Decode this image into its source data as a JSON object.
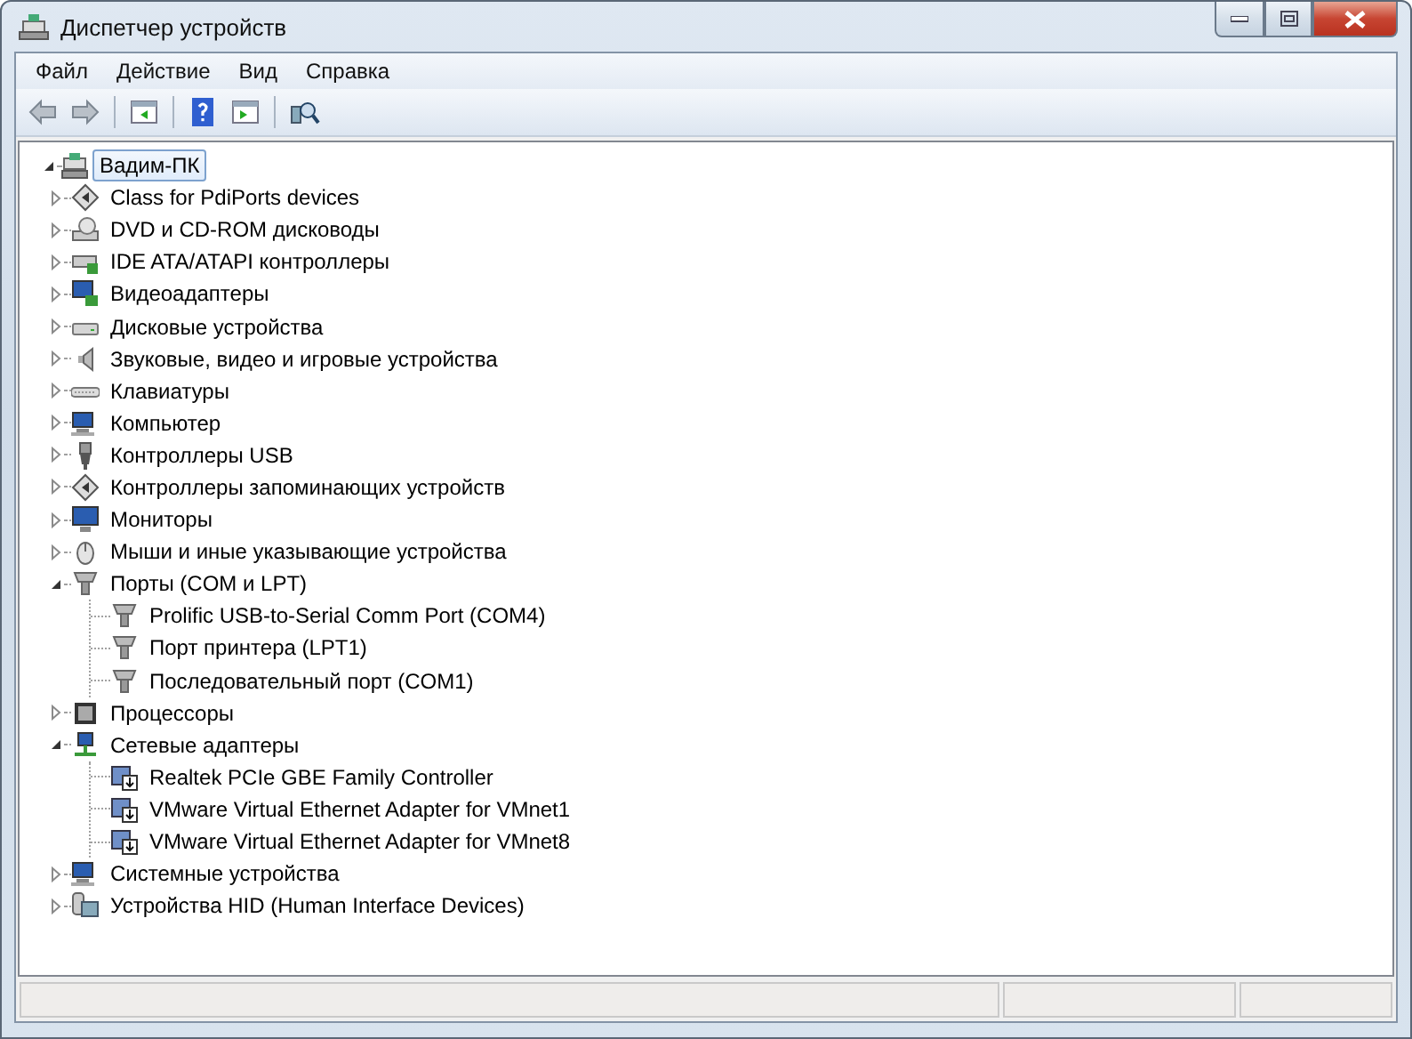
{
  "window": {
    "title": "Диспетчер устройств"
  },
  "menu": [
    {
      "label": "Файл"
    },
    {
      "label": "Действие"
    },
    {
      "label": "Вид"
    },
    {
      "label": "Справка"
    }
  ],
  "tree": {
    "label": "Вадим-ПК",
    "expanded": true,
    "selected": true,
    "children": [
      {
        "label": "Class for PdiPorts devices",
        "expanded": false
      },
      {
        "label": "DVD и CD-ROM дисководы",
        "expanded": false
      },
      {
        "label": "IDE ATA/ATAPI контроллеры",
        "expanded": false
      },
      {
        "label": "Видеоадаптеры",
        "expanded": false
      },
      {
        "label": "Дисковые устройства",
        "expanded": false
      },
      {
        "label": "Звуковые, видео и игровые устройства",
        "expanded": false
      },
      {
        "label": "Клавиатуры",
        "expanded": false
      },
      {
        "label": "Компьютер",
        "expanded": false
      },
      {
        "label": "Контроллеры USB",
        "expanded": false
      },
      {
        "label": "Контроллеры запоминающих устройств",
        "expanded": false
      },
      {
        "label": "Мониторы",
        "expanded": false
      },
      {
        "label": "Мыши и иные указывающие устройства",
        "expanded": false
      },
      {
        "label": "Порты (COM и LPT)",
        "expanded": true,
        "children": [
          {
            "label": "Prolific USB-to-Serial Comm Port (COM4)"
          },
          {
            "label": "Порт принтера (LPT1)"
          },
          {
            "label": "Последовательный порт (COM1)"
          }
        ]
      },
      {
        "label": "Процессоры",
        "expanded": false
      },
      {
        "label": "Сетевые адаптеры",
        "expanded": true,
        "children": [
          {
            "label": "Realtek PCIe GBE Family Controller"
          },
          {
            "label": "VMware Virtual Ethernet Adapter for VMnet1"
          },
          {
            "label": "VMware Virtual Ethernet Adapter for VMnet8"
          }
        ]
      },
      {
        "label": "Системные устройства",
        "expanded": false
      },
      {
        "label": "Устройства HID (Human Interface Devices)",
        "expanded": false
      }
    ]
  }
}
